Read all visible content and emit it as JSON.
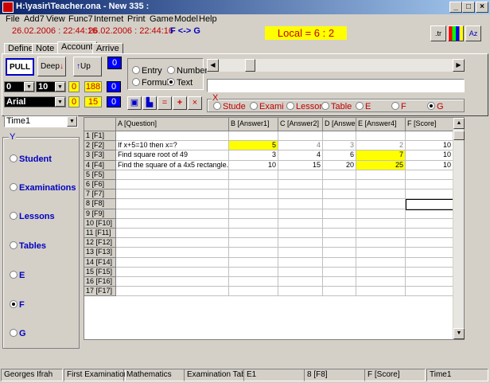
{
  "window": {
    "title": "H:\\yasir\\Teacher.ona - New 335 :"
  },
  "menu": [
    "File",
    "Add7",
    "View",
    "Func7",
    "Internet",
    "Print",
    "Game",
    "Model",
    "Help"
  ],
  "info": {
    "date1": "26.02.2006 : 22:44:16",
    "date2": "26.02.2006 : 22:44:16",
    "swap": "F <-> G",
    "local": "Local = 6 : 2"
  },
  "toolbar_icons": {
    "tr": ".tr",
    "az": "Az"
  },
  "tabs": [
    "Define",
    "Note",
    "Account",
    "Arrive"
  ],
  "buttons": {
    "pull": "PULL",
    "deep": "Deep",
    "up": "Up"
  },
  "boxes": {
    "blue1": "0",
    "combo1": "0",
    "combo2": "10",
    "y1": "0",
    "y2": "188",
    "blue2": "0",
    "font": "Arial",
    "y3": "0",
    "y4": "15",
    "blue3": "0"
  },
  "mode_radios": {
    "entry": "Entry",
    "number": "Number",
    "formula": "Formula",
    "text": "Text",
    "selected": "Text"
  },
  "x_group": {
    "caption": "X",
    "items": [
      "Stude",
      "Exami",
      "Lesson",
      "Table",
      "E",
      "F",
      "G"
    ],
    "selected": "G"
  },
  "y_group": {
    "caption": "Y",
    "items": [
      "Student",
      "Examinations",
      "Lessons",
      "Tables",
      "E",
      "F",
      "G"
    ],
    "selected": "F"
  },
  "time_combo": "Time1",
  "grid": {
    "columns": [
      "A  [Question]",
      "B  [Answer1]",
      "C  [Answer2]",
      "D  [Answe",
      "E  [Answer4]",
      "F  [Score]"
    ],
    "rows": [
      {
        "label": "1  [F1]",
        "cells": [
          "",
          "",
          "",
          "",
          "",
          ""
        ]
      },
      {
        "label": "2  [F2]",
        "cells": [
          "If x+5=10  then x=?",
          "5",
          "4",
          "3",
          "2",
          "10"
        ]
      },
      {
        "label": "3  [F3]",
        "cells": [
          "Find square root of 49",
          "3",
          "4",
          "6",
          "7",
          "10"
        ]
      },
      {
        "label": "4  [F4]",
        "cells": [
          "Find the square of a 4x5 rectangle.",
          "10",
          "15",
          "20",
          "25",
          "10"
        ]
      },
      {
        "label": "5  [F5]",
        "cells": [
          "",
          "",
          "",
          "",
          "",
          ""
        ]
      },
      {
        "label": "6  [F6]",
        "cells": [
          "",
          "",
          "",
          "",
          "",
          ""
        ]
      },
      {
        "label": "7  [F7]",
        "cells": [
          "",
          "",
          "",
          "",
          "",
          ""
        ]
      },
      {
        "label": "8  [F8]",
        "cells": [
          "",
          "",
          "",
          "",
          "",
          ""
        ]
      },
      {
        "label": "9  [F9]",
        "cells": [
          "",
          "",
          "",
          "",
          "",
          ""
        ]
      },
      {
        "label": "10  [F10]",
        "cells": [
          "",
          "",
          "",
          "",
          "",
          ""
        ]
      },
      {
        "label": "11  [F11]",
        "cells": [
          "",
          "",
          "",
          "",
          "",
          ""
        ]
      },
      {
        "label": "12  [F12]",
        "cells": [
          "",
          "",
          "",
          "",
          "",
          ""
        ]
      },
      {
        "label": "13  [F13]",
        "cells": [
          "",
          "",
          "",
          "",
          "",
          ""
        ]
      },
      {
        "label": "14  [F14]",
        "cells": [
          "",
          "",
          "",
          "",
          "",
          ""
        ]
      },
      {
        "label": "15  [F15]",
        "cells": [
          "",
          "",
          "",
          "",
          "",
          ""
        ]
      },
      {
        "label": "16  [F16]",
        "cells": [
          "",
          "",
          "",
          "",
          "",
          ""
        ]
      },
      {
        "label": "17  [F17]",
        "cells": [
          "",
          "",
          "",
          "",
          "",
          ""
        ]
      }
    ],
    "highlight": [
      [
        1,
        1
      ],
      [
        2,
        4
      ],
      [
        3,
        4
      ]
    ]
  },
  "status": [
    "Georges Ifrah",
    "First Examination",
    "Mathematics",
    "Examination Table",
    "E1",
    "8   [F8]",
    "F   [Score]",
    "Time1"
  ]
}
